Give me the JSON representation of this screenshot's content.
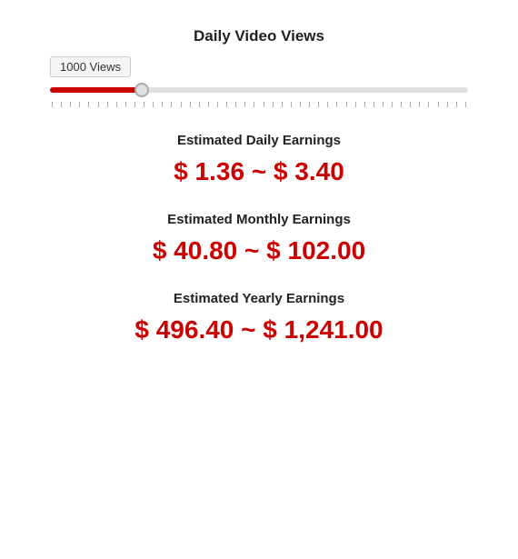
{
  "header": {
    "title": "Daily Video Views"
  },
  "slider": {
    "label": "1000 Views",
    "min": 0,
    "max": 1000000,
    "value": 1000,
    "fill_percent": 22
  },
  "earnings": {
    "daily": {
      "label": "Estimated Daily Earnings",
      "value": "$ 1.36 ~ $ 3.40"
    },
    "monthly": {
      "label": "Estimated Monthly Earnings",
      "value": "$ 40.80 ~ $ 102.00"
    },
    "yearly": {
      "label": "Estimated Yearly Earnings",
      "value": "$ 496.40 ~ $ 1,241.00"
    }
  }
}
